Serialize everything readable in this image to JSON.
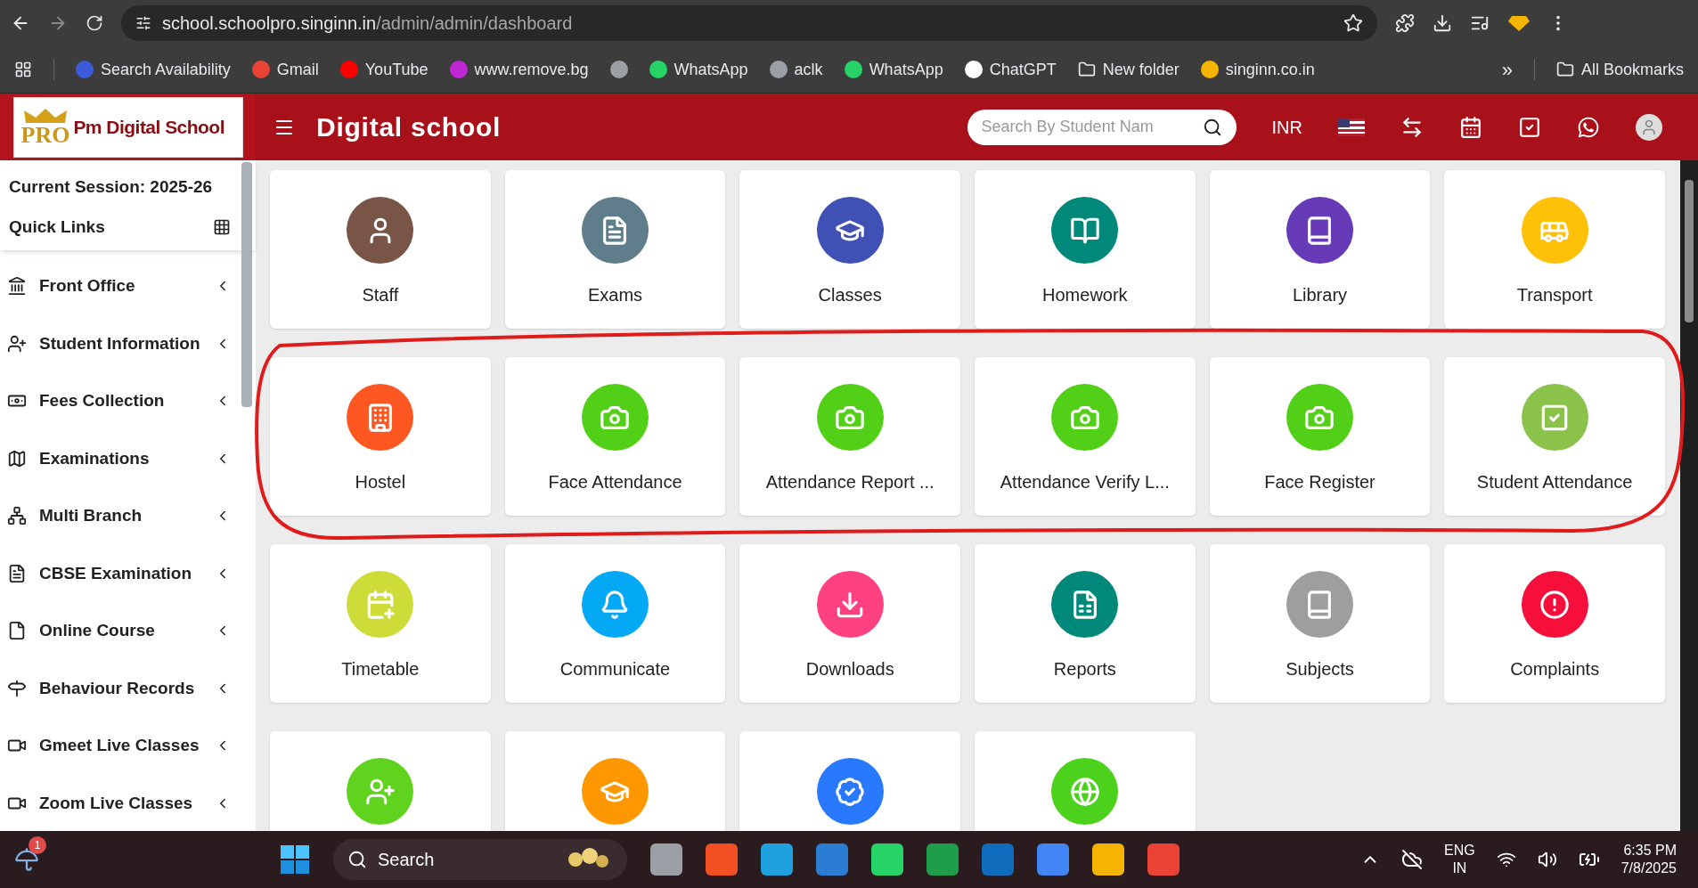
{
  "browser": {
    "url_host": "school.schoolpro.singinn.in",
    "url_path": "/admin/admin/dashboard",
    "bookmarks": [
      {
        "kind": "link",
        "label": "Search Availability"
      },
      {
        "kind": "link",
        "label": "Gmail"
      },
      {
        "kind": "link",
        "label": "YouTube"
      },
      {
        "kind": "link",
        "label": "www.remove.bg"
      },
      {
        "kind": "icon"
      },
      {
        "kind": "link",
        "label": "WhatsApp"
      },
      {
        "kind": "link",
        "label": "aclk"
      },
      {
        "kind": "link",
        "label": "WhatsApp"
      },
      {
        "kind": "link",
        "label": "ChatGPT"
      },
      {
        "kind": "folder",
        "label": "New folder"
      },
      {
        "kind": "link",
        "label": "singinn.co.in"
      }
    ],
    "more": "»",
    "all_bookmarks": "All Bookmarks"
  },
  "header": {
    "logo_badge": "PRO",
    "logo_text": "Pm Digital School",
    "title": "Digital school",
    "search": {
      "placeholder": "Search By Student Nam"
    },
    "currency": "INR"
  },
  "sidebar": {
    "session": "Current Session: 2025-26",
    "quick_links": "Quick Links",
    "items": [
      {
        "label": "Front Office",
        "expanded": false
      },
      {
        "label": "Student Information",
        "expanded": false
      },
      {
        "label": "Fees Collection",
        "expanded": false
      },
      {
        "label": "Examinations",
        "expanded": false
      },
      {
        "label": "Multi Branch",
        "expanded": false
      },
      {
        "label": "CBSE Examination",
        "expanded": false
      },
      {
        "label": "Online Course",
        "expanded": false
      },
      {
        "label": "Behaviour Records",
        "expanded": false
      },
      {
        "label": "Gmeet Live Classes",
        "expanded": false
      },
      {
        "label": "Zoom Live Classes",
        "expanded": false
      }
    ]
  },
  "tiles": [
    {
      "label": "Staff",
      "color": "#795548"
    },
    {
      "label": "Exams",
      "color": "#607d8b"
    },
    {
      "label": "Classes",
      "color": "#3f51b5"
    },
    {
      "label": "Homework",
      "color": "#00897b"
    },
    {
      "label": "Library",
      "color": "#673ab7"
    },
    {
      "label": "Transport",
      "color": "#ffc107"
    },
    {
      "label": "Hostel",
      "color": "#ff5722"
    },
    {
      "label": "Face Attendance",
      "color": "#52d017"
    },
    {
      "label": "Attendance Report ...",
      "color": "#52d017"
    },
    {
      "label": "Attendance Verify L...",
      "color": "#52d017"
    },
    {
      "label": "Face Register",
      "color": "#52d017"
    },
    {
      "label": "Student Attendance",
      "color": "#8bc34a"
    },
    {
      "label": "Timetable",
      "color": "#cddc39"
    },
    {
      "label": "Communicate",
      "color": "#03a9f4"
    },
    {
      "label": "Downloads",
      "color": "#ff4081"
    },
    {
      "label": "Reports",
      "color": "#00897b"
    },
    {
      "label": "Subjects",
      "color": "#9e9e9e"
    },
    {
      "label": "Complaints",
      "color": "#f50f3a"
    },
    {
      "color": "#5fd31d"
    },
    {
      "color": "#ff9800"
    },
    {
      "color": "#2979ff"
    },
    {
      "color": "#4cd11c"
    }
  ],
  "taskbar": {
    "weather_badge": "1",
    "search": "Search",
    "lang": "ENG",
    "region": "IN",
    "time": "6:35 PM",
    "date": "7/8/2025"
  }
}
